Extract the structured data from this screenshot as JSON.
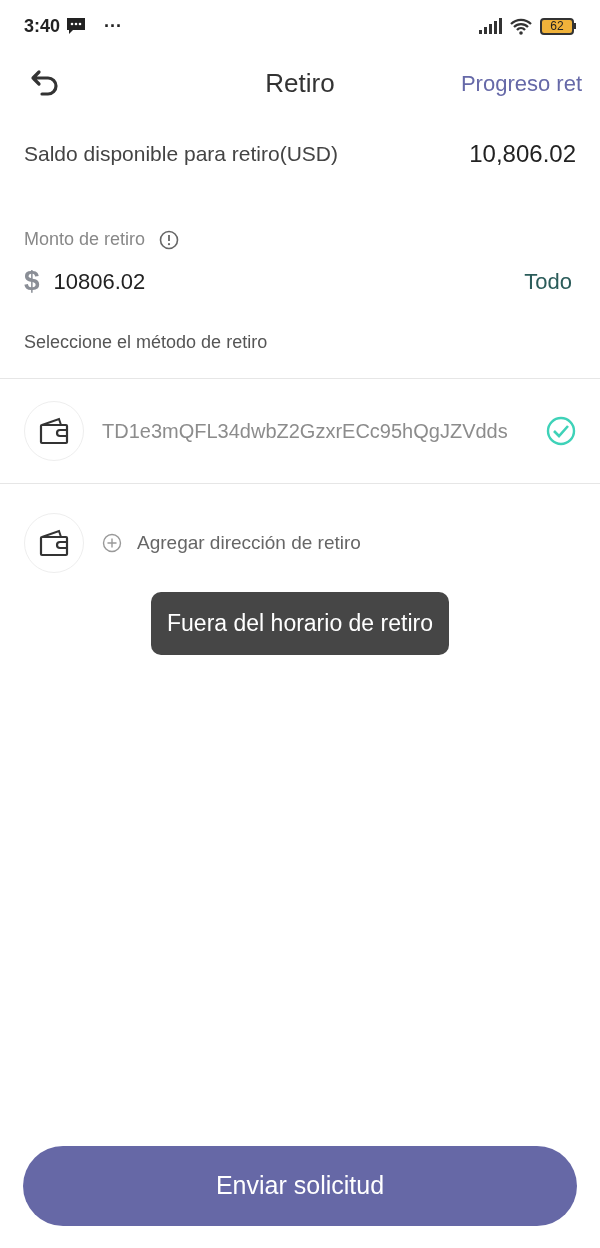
{
  "status_bar": {
    "time": "3:40",
    "dots": "···",
    "battery": "62"
  },
  "header": {
    "title": "Retiro",
    "action": "Progreso ret"
  },
  "balance": {
    "label": "Saldo disponible para retiro(USD)",
    "value": "10,806.02"
  },
  "amount": {
    "label": "Monto de retiro",
    "currency": "$",
    "value": "10806.02",
    "all": "Todo"
  },
  "method_label": "Seleccione el método de retiro",
  "methods": [
    {
      "kind": "address",
      "text": "TD1e3mQFL34dwbZ2GzxrECc95hQgJZVdds",
      "selected": true
    },
    {
      "kind": "add",
      "text": "Agregar dirección de retiro"
    }
  ],
  "toast": "Fuera del horario de retiro",
  "submit": "Enviar solicitud"
}
